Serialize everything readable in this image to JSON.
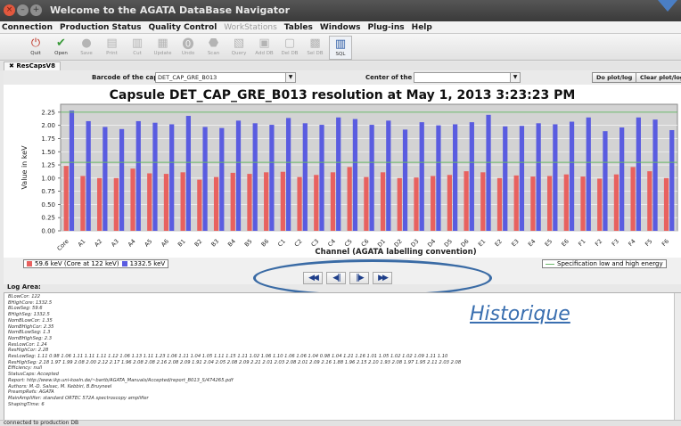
{
  "window": {
    "title": "Welcome to the AGATA DataBase Navigator"
  },
  "menubar": {
    "items": [
      {
        "label": "Connection",
        "enabled": true
      },
      {
        "label": "Production Status",
        "enabled": true
      },
      {
        "label": "Quality Control",
        "enabled": true
      },
      {
        "label": "WorkStations",
        "enabled": false
      },
      {
        "label": "Tables",
        "enabled": true
      },
      {
        "label": "Windows",
        "enabled": true
      },
      {
        "label": "Plug-ins",
        "enabled": true
      },
      {
        "label": "Help",
        "enabled": true
      }
    ]
  },
  "toolbar": {
    "buttons": [
      {
        "label": "Quit",
        "icon": "quit-icon",
        "enabled": true
      },
      {
        "label": "Open",
        "icon": "open-icon",
        "enabled": true
      },
      {
        "label": "Save",
        "icon": "save-icon",
        "enabled": false
      },
      {
        "label": "Print",
        "icon": "print-icon",
        "enabled": false
      },
      {
        "label": "Cut",
        "icon": "cut-icon",
        "enabled": false
      },
      {
        "label": "Update",
        "icon": "update-icon",
        "enabled": false
      },
      {
        "label": "Undo",
        "icon": "undo-icon",
        "enabled": false
      },
      {
        "label": "Scan",
        "icon": "scan-icon",
        "enabled": false
      },
      {
        "label": "Query",
        "icon": "query-icon",
        "enabled": false
      },
      {
        "label": "Add DB",
        "icon": "add-db-icon",
        "enabled": false
      },
      {
        "label": "Del DB",
        "icon": "del-db-icon",
        "enabled": false
      },
      {
        "label": "Sel DB",
        "icon": "sel-db-icon",
        "enabled": false
      },
      {
        "label": "SQL",
        "icon": "sql-icon",
        "enabled": true
      }
    ]
  },
  "tab": {
    "label": "ResCapsV8"
  },
  "controls": {
    "barcode_label": "Barcode of the capsule",
    "barcode_value": "DET_CAP_GRE_B013",
    "center_label": "Center of the CAT",
    "center_value": "",
    "do_plot_label": "Do plot/log",
    "clear_plot_label": "Clear plot/log"
  },
  "chart_data": {
    "type": "bar",
    "title": "Capsule DET_CAP_GRE_B013 resolution at May 1, 2013 3:23:23 PM",
    "xlabel": "Channel (AGATA labelling convention)",
    "ylabel": "Value in keV",
    "ylim": [
      0,
      2.4
    ],
    "yticks": [
      "0.00",
      "0.25",
      "0.50",
      "0.75",
      "1.00",
      "1.25",
      "1.50",
      "1.75",
      "2.00",
      "2.25"
    ],
    "grid": true,
    "categories": [
      "Core",
      "A1",
      "A2",
      "A3",
      "A4",
      "A5",
      "A6",
      "B1",
      "B2",
      "B3",
      "B4",
      "B5",
      "B6",
      "C1",
      "C2",
      "C3",
      "C4",
      "C5",
      "C6",
      "D1",
      "D2",
      "D3",
      "D4",
      "D5",
      "D6",
      "E1",
      "E2",
      "E3",
      "E4",
      "E5",
      "E6",
      "F1",
      "F2",
      "F3",
      "F4",
      "F5",
      "F6"
    ],
    "series": [
      {
        "name": "59.6 keV (Core at 122 keV)",
        "color": "#e8615f",
        "values": [
          1.23,
          1.04,
          1.0,
          1.0,
          1.18,
          1.09,
          1.08,
          1.11,
          0.97,
          1.02,
          1.1,
          1.08,
          1.11,
          1.12,
          1.02,
          1.06,
          1.11,
          1.21,
          1.02,
          1.11,
          1.0,
          1.01,
          1.04,
          1.06,
          1.13,
          1.11,
          1.0,
          1.05,
          1.03,
          1.04,
          1.07,
          1.03,
          0.99,
          1.07,
          1.21,
          1.13,
          1.0
        ]
      },
      {
        "name": "1332.5 keV",
        "color": "#5a5ce0",
        "values": [
          2.28,
          2.08,
          1.97,
          1.93,
          2.08,
          2.05,
          2.02,
          2.18,
          1.97,
          1.95,
          2.09,
          2.04,
          2.01,
          2.14,
          2.04,
          2.01,
          2.15,
          2.12,
          2.01,
          2.09,
          1.92,
          2.06,
          2.0,
          2.02,
          2.06,
          2.2,
          1.98,
          1.99,
          2.04,
          2.02,
          2.07,
          2.15,
          1.89,
          1.96,
          2.15,
          2.11,
          1.91
        ]
      }
    ],
    "reference_lines": [
      {
        "name": "Specification low and high energy",
        "values": [
          1.3,
          2.25
        ],
        "color": "#6ab86a"
      }
    ]
  },
  "legend": {
    "main": [
      {
        "label": "59.6 keV (Core at 122 keV)",
        "color": "#e8615f"
      },
      {
        "label": "1332.5 keV",
        "color": "#5a5ce0"
      }
    ],
    "spec": "Specification low and high energy"
  },
  "nav": {
    "buttons": [
      {
        "glyph": "◀◀",
        "name": "first"
      },
      {
        "glyph": "◀‖",
        "name": "previous"
      },
      {
        "glyph": "‖▶",
        "name": "next"
      },
      {
        "glyph": "▶▶",
        "name": "last"
      }
    ]
  },
  "log": {
    "label": "Log Area:",
    "lines": [
      "BLowCor: 122",
      "BHighCore: 1332.5",
      "BLowSeg: 59.6",
      "BHighSeg: 1332.5",
      "NomBLowCor: 1.35",
      "NomBHighCor: 2.35",
      "NomBLowSeg: 1.3",
      "NomBHighSeg: 2.3",
      "ResLowCor: 1.24",
      "ResHighCor: 2.28",
      "ResLowSeg: 1.11 0.98 1.06 1.11 1.11 1.11 1.12 1.06 1.13 1.11 1.23 1.06 1.11 1.04 1.05 1.11 1.15 1.11 1.02 1.06 1.10 1.06 1.06 1.04 0.98 1.04 1.21 1.16 1.01 1.05 1.02 1.02 1.09 1.11 1.10",
      "ResHighSeg: 2.18 1.97 1.99 2.08 2.00 2.12 2.17 1.96 2.08 2.08 2.16 2.08 2.09 1.91 2.04 2.05 2.08 2.09 2.21 2.01 2.03 2.08 2.01 2.09 2.16 1.88 1.96 2.15 2.10 1.93 2.08 1.97 1.95 2.11 2.03 2.08",
      "Efficiency: null",
      "StatusCaps: Accepted",
      "Report: http://www.ikp.uni-koeln.de/~bartb/AGATA_Manuals/Accepted/report_B013_S/474265.pdf",
      "Authors: M.-D. Salsac, M. Kebbiri, B.Bruyneel",
      "PreampRefs: AGATA",
      "MainAmplifier: standard ORTEC 572A spectroscopy amplifier",
      "ShapingTime: 6"
    ]
  },
  "annotation": {
    "text": "Historique"
  },
  "status": {
    "text": "connected to production DB"
  }
}
